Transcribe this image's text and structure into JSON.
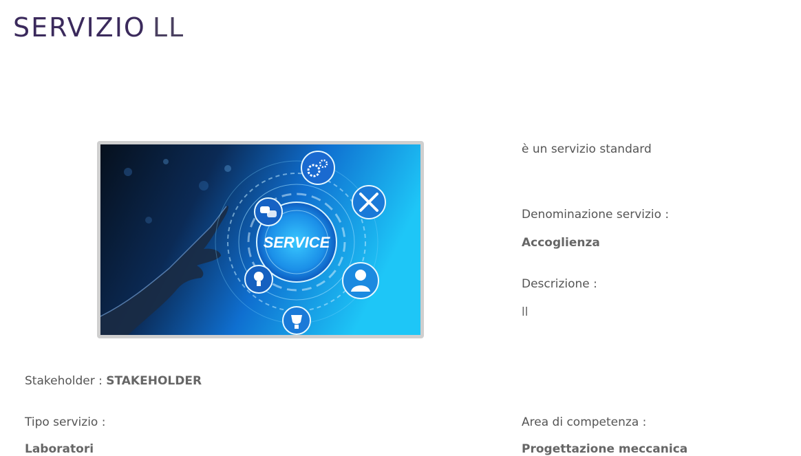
{
  "header": {
    "title": "SERVIZIO",
    "suffix": "LL"
  },
  "image": {
    "label": "SERVICE"
  },
  "info": {
    "standard_text": "è un servizio standard",
    "denominazione_label": "Denominazione servizio :",
    "denominazione_value": "Accoglienza",
    "descrizione_label": "Descrizione :",
    "descrizione_value": "ll"
  },
  "stakeholder": {
    "label": "Stakeholder :",
    "value": "STAKEHOLDER"
  },
  "tipo_servizio": {
    "label": "Tipo servizio :",
    "value": "Laboratori"
  },
  "area_competenza": {
    "label": "Area di competenza :",
    "value": "Progettazione meccanica"
  },
  "colors": {
    "title": "#3b2a5c",
    "accent": "#2aa8f0",
    "frame": "#cfcfcf"
  }
}
